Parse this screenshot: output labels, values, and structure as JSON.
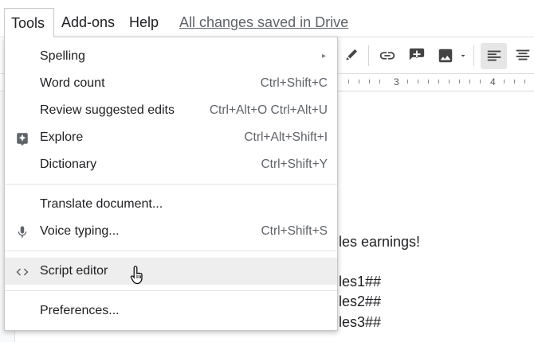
{
  "menubar": {
    "tools": "Tools",
    "addons": "Add-ons",
    "help": "Help",
    "saved": "All changes saved in Drive"
  },
  "toolbar": {
    "icons": [
      "highlight-pen-icon",
      "link-icon",
      "add-comment-icon",
      "insert-image-icon",
      "align-left-icon",
      "align-center-icon"
    ]
  },
  "ruler": {
    "marks": [
      "3",
      "4"
    ]
  },
  "menu": {
    "items": [
      {
        "label": "Spelling",
        "shortcut": "",
        "submenu": "▸"
      },
      {
        "label": "Word count",
        "shortcut": "Ctrl+Shift+C"
      },
      {
        "label": "Review suggested edits",
        "shortcut": "Ctrl+Alt+O Ctrl+Alt+U"
      },
      {
        "label": "Explore",
        "shortcut": "Ctrl+Alt+Shift+I",
        "icon": "explore-icon"
      },
      {
        "label": "Dictionary",
        "shortcut": "Ctrl+Shift+Y"
      },
      {
        "label": "Translate document...",
        "shortcut": ""
      },
      {
        "label": "Voice typing...",
        "shortcut": "Ctrl+Shift+S",
        "icon": "microphone-icon"
      },
      {
        "label": "Script editor",
        "shortcut": "",
        "icon": "code-brackets-icon"
      },
      {
        "label": "Preferences...",
        "shortcut": ""
      }
    ]
  },
  "document": {
    "lines": [
      "les earnings!",
      "les1##",
      "les2##",
      "les3##"
    ]
  },
  "colors": {
    "menu_hover": "#eeeeee",
    "text": "#202124",
    "muted": "#5f6368"
  }
}
